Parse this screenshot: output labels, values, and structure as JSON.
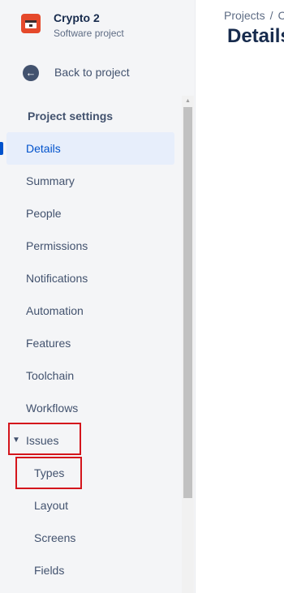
{
  "project": {
    "name": "Crypto 2",
    "type": "Software project"
  },
  "back": {
    "label": "Back to project"
  },
  "settings": {
    "title": "Project settings",
    "items": [
      {
        "label": "Details",
        "active": true
      },
      {
        "label": "Summary"
      },
      {
        "label": "People"
      },
      {
        "label": "Permissions"
      },
      {
        "label": "Notifications"
      },
      {
        "label": "Automation"
      },
      {
        "label": "Features"
      },
      {
        "label": "Toolchain"
      },
      {
        "label": "Workflows"
      },
      {
        "label": "Issues",
        "expanded": true
      },
      {
        "label": "Types"
      },
      {
        "label": "Layout"
      },
      {
        "label": "Screens"
      },
      {
        "label": "Fields"
      }
    ]
  },
  "breadcrumb": {
    "projects": "Projects",
    "separator": "/",
    "next": "C"
  },
  "page": {
    "title": "Details"
  },
  "colors": {
    "accent": "#0052cc",
    "active_bg": "#e7eefb",
    "highlight": "#d4151c",
    "project_icon": "#e5492b"
  },
  "icons": {
    "project": "project-avatar-icon",
    "back": "arrow-left-icon",
    "issues_toggle": "chevron-down-icon"
  }
}
